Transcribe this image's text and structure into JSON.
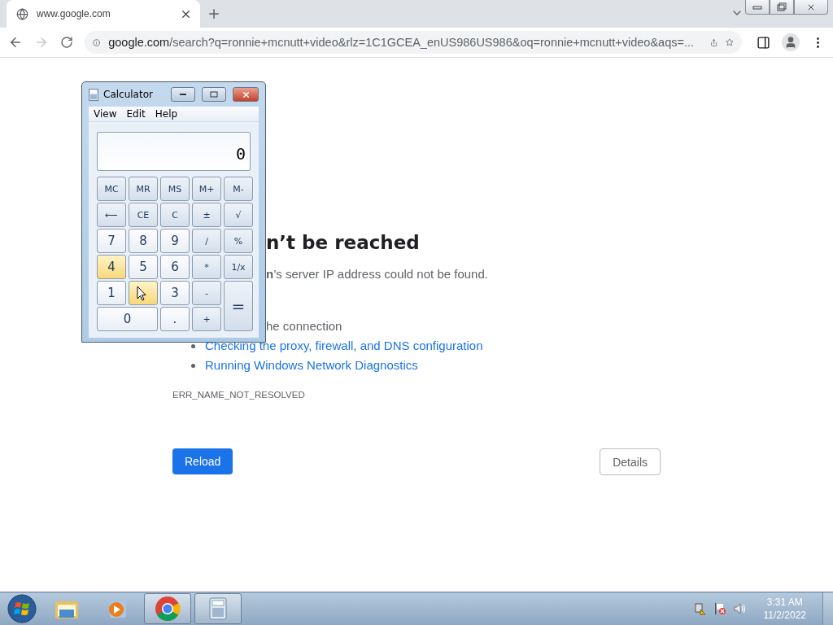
{
  "browser": {
    "tab": {
      "title": "www.google.com",
      "selected": true
    },
    "address": {
      "host": "google.com",
      "rest": "/search?q=ronnie+mcnutt+video&rlz=1C1GCEA_enUS986US986&oq=ronnie+mcnutt+video&aqs=..."
    },
    "forward_disabled": true
  },
  "error_page": {
    "heading": "n’t be reached",
    "message": "**n**’s server IP address could not be found.",
    "suggestions": [
      {
        "text": "he connection",
        "kind": "plain"
      },
      {
        "text": "Checking the proxy, firewall, and DNS configuration",
        "kind": "link"
      },
      {
        "text": "Running Windows Network Diagnostics",
        "kind": "link"
      }
    ],
    "error_code": "ERR_NAME_NOT_RESOLVED",
    "reload": "Reload",
    "details": "Details"
  },
  "calculator": {
    "title": "Calculator",
    "menu": [
      "View",
      "Edit",
      "Help"
    ],
    "display": "0",
    "keys": [
      {
        "label": "MC",
        "kind": "op",
        "highlighted": false
      },
      {
        "label": "MR",
        "kind": "op",
        "highlighted": false
      },
      {
        "label": "MS",
        "kind": "op",
        "highlighted": false
      },
      {
        "label": "M+",
        "kind": "op",
        "highlighted": false
      },
      {
        "label": "M-",
        "kind": "op",
        "highlighted": false
      },
      {
        "label": "⟵",
        "kind": "op",
        "highlighted": false
      },
      {
        "label": "CE",
        "kind": "op",
        "highlighted": false
      },
      {
        "label": "C",
        "kind": "op",
        "highlighted": false
      },
      {
        "label": "±",
        "kind": "op",
        "highlighted": false
      },
      {
        "label": "√",
        "kind": "op",
        "highlighted": false
      },
      {
        "label": "7",
        "kind": "digit",
        "highlighted": false
      },
      {
        "label": "8",
        "kind": "digit",
        "highlighted": false
      },
      {
        "label": "9",
        "kind": "digit",
        "highlighted": false
      },
      {
        "label": "/",
        "kind": "op",
        "highlighted": false
      },
      {
        "label": "%",
        "kind": "op",
        "highlighted": false
      },
      {
        "label": "4",
        "kind": "digit",
        "highlighted": true
      },
      {
        "label": "5",
        "kind": "digit",
        "highlighted": false
      },
      {
        "label": "6",
        "kind": "digit",
        "highlighted": false
      },
      {
        "label": "*",
        "kind": "op",
        "highlighted": false
      },
      {
        "label": "1/x",
        "kind": "op",
        "highlighted": false
      },
      {
        "label": "1",
        "kind": "digit",
        "highlighted": false
      },
      {
        "kind": "digit",
        "highlighted": true,
        "cursor": true
      },
      {
        "label": "3",
        "kind": "digit",
        "highlighted": false
      },
      {
        "label": "-",
        "kind": "op",
        "highlighted": false
      },
      {
        "label": "=",
        "kind": "equals",
        "highlighted": false
      },
      {
        "label": "0",
        "kind": "zero",
        "highlighted": false
      },
      {
        "label": ".",
        "kind": "digit",
        "highlighted": false
      },
      {
        "label": "+",
        "kind": "op",
        "highlighted": false
      }
    ]
  },
  "taskbar": {
    "apps": [
      {
        "kind": "folder",
        "selected": false
      },
      {
        "kind": "media",
        "selected": false
      },
      {
        "kind": "chrome",
        "selected": true
      },
      {
        "kind": "calculator",
        "selected": true
      }
    ],
    "time": "3:31 AM",
    "date": "11/2/2022"
  }
}
